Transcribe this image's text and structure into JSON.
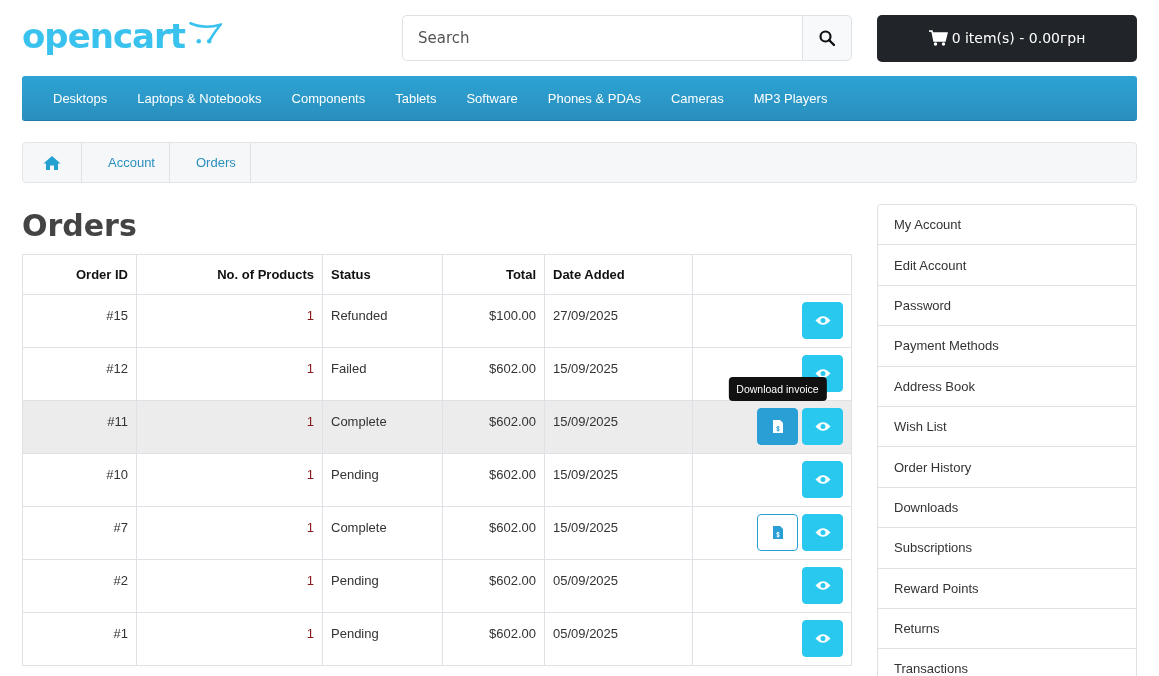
{
  "logo": {
    "text": "opencart"
  },
  "search": {
    "placeholder": "Search"
  },
  "cart": {
    "label": "0 item(s) - 0.00грн"
  },
  "menu": [
    {
      "label": "Desktops"
    },
    {
      "label": "Laptops & Notebooks"
    },
    {
      "label": "Components"
    },
    {
      "label": "Tablets"
    },
    {
      "label": "Software"
    },
    {
      "label": "Phones & PDAs"
    },
    {
      "label": "Cameras"
    },
    {
      "label": "MP3 Players"
    }
  ],
  "breadcrumb": [
    {
      "label": "Account"
    },
    {
      "label": "Orders"
    }
  ],
  "heading": "Orders",
  "table": {
    "columns": [
      {
        "label": "Order ID"
      },
      {
        "label": "No. of Products"
      },
      {
        "label": "Status"
      },
      {
        "label": "Total"
      },
      {
        "label": "Date Added"
      }
    ],
    "rows": [
      {
        "id": "#15",
        "products": "1",
        "status": "Refunded",
        "total": "$100.00",
        "date": "27/09/2025",
        "hovered": false,
        "invoice": false
      },
      {
        "id": "#12",
        "products": "1",
        "status": "Failed",
        "total": "$602.00",
        "date": "15/09/2025",
        "hovered": false,
        "invoice": false
      },
      {
        "id": "#11",
        "products": "1",
        "status": "Complete",
        "total": "$602.00",
        "date": "15/09/2025",
        "hovered": true,
        "invoice": true,
        "tooltip": "Download invoice"
      },
      {
        "id": "#10",
        "products": "1",
        "status": "Pending",
        "total": "$602.00",
        "date": "15/09/2025",
        "hovered": false,
        "invoice": false
      },
      {
        "id": "#7",
        "products": "1",
        "status": "Complete",
        "total": "$602.00",
        "date": "15/09/2025",
        "hovered": false,
        "invoice": true
      },
      {
        "id": "#2",
        "products": "1",
        "status": "Pending",
        "total": "$602.00",
        "date": "05/09/2025",
        "hovered": false,
        "invoice": false
      },
      {
        "id": "#1",
        "products": "1",
        "status": "Pending",
        "total": "$602.00",
        "date": "05/09/2025",
        "hovered": false,
        "invoice": false
      }
    ]
  },
  "sidebar": {
    "items": [
      {
        "label": "My Account"
      },
      {
        "label": "Edit Account"
      },
      {
        "label": "Password"
      },
      {
        "label": "Payment Methods"
      },
      {
        "label": "Address Book"
      },
      {
        "label": "Wish List"
      },
      {
        "label": "Order History"
      },
      {
        "label": "Downloads"
      },
      {
        "label": "Subscriptions"
      },
      {
        "label": "Reward Points"
      },
      {
        "label": "Returns"
      },
      {
        "label": "Transactions"
      }
    ]
  }
}
